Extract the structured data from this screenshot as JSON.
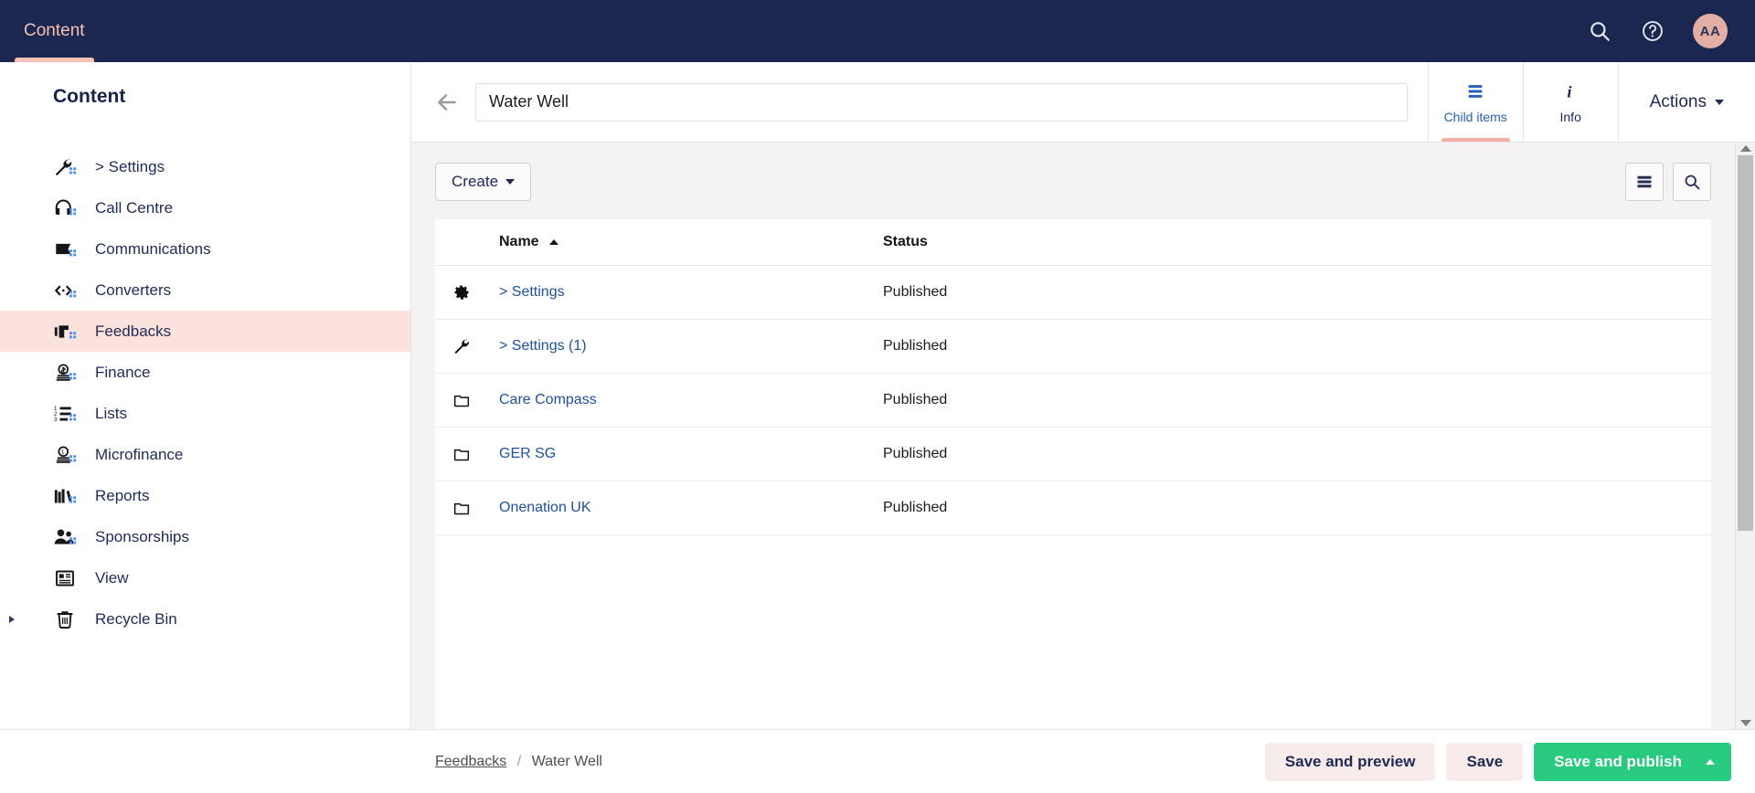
{
  "topbar": {
    "active_tab": "Content",
    "icons": {
      "search": "search-icon",
      "help": "help-circle-icon"
    },
    "avatar_initials": "AA"
  },
  "sidebar": {
    "title": "Content",
    "items": [
      {
        "label": "> Settings",
        "icon": "wrench-icon",
        "active": false,
        "expandable": false
      },
      {
        "label": "Call Centre",
        "icon": "headset-icon",
        "active": false,
        "expandable": false
      },
      {
        "label": "Communications",
        "icon": "speech-bubble-icon",
        "active": false,
        "expandable": false
      },
      {
        "label": "Converters",
        "icon": "code-arrows-icon",
        "active": false,
        "expandable": false
      },
      {
        "label": "Feedbacks",
        "icon": "megaphone-icon",
        "active": true,
        "expandable": false
      },
      {
        "label": "Finance",
        "icon": "coins-icon",
        "active": false,
        "expandable": false
      },
      {
        "label": "Lists",
        "icon": "numbered-list-icon",
        "active": false,
        "expandable": false
      },
      {
        "label": "Microfinance",
        "icon": "coin-stack-icon",
        "active": false,
        "expandable": false
      },
      {
        "label": "Reports",
        "icon": "books-icon",
        "active": false,
        "expandable": false
      },
      {
        "label": "Sponsorships",
        "icon": "people-icon",
        "active": false,
        "expandable": false
      },
      {
        "label": "View",
        "icon": "article-icon",
        "active": false,
        "expandable": false
      },
      {
        "label": "Recycle Bin",
        "icon": "trash-icon",
        "active": false,
        "expandable": true
      }
    ]
  },
  "header": {
    "back_icon": "arrow-left-icon",
    "title_value": "Water Well",
    "title_placeholder": "Enter a name...",
    "tabs": [
      {
        "label": "Child items",
        "icon": "list-lines-icon",
        "active": true
      },
      {
        "label": "Info",
        "icon": "info-italic-icon",
        "active": false
      }
    ],
    "actions_label": "Actions"
  },
  "toolbar": {
    "create_label": "Create",
    "list_view_icon": "list-view-icon",
    "search_icon": "search-icon"
  },
  "table": {
    "columns": [
      {
        "key": "icon",
        "label": ""
      },
      {
        "key": "name",
        "label": "Name",
        "sort": "asc"
      },
      {
        "key": "status",
        "label": "Status",
        "sort": null
      }
    ],
    "rows": [
      {
        "icon": "gear-icon",
        "name": "> Settings",
        "status": "Published"
      },
      {
        "icon": "wrench-icon",
        "name": "> Settings (1)",
        "status": "Published"
      },
      {
        "icon": "folder-icon",
        "name": "Care Compass",
        "status": "Published"
      },
      {
        "icon": "folder-icon",
        "name": "GER SG",
        "status": "Published"
      },
      {
        "icon": "folder-icon",
        "name": "Onenation UK",
        "status": "Published"
      }
    ]
  },
  "footer": {
    "breadcrumb": {
      "parent": "Feedbacks",
      "separator": "/",
      "current": "Water Well"
    },
    "buttons": {
      "save_and_preview": "Save and preview",
      "save": "Save",
      "save_and_publish": "Save and publish"
    }
  },
  "colors": {
    "topbar_bg": "#1c2750",
    "accent_pink": "#f7c3b9",
    "active_nav_bg": "#fce2dd",
    "link_blue": "#20519c",
    "publish_green": "#27ca7f",
    "content_bg": "#f4f2f3"
  }
}
